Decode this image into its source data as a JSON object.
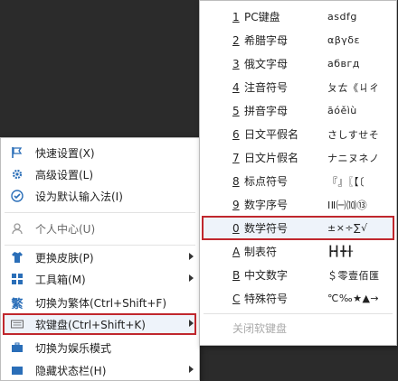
{
  "main_menu": {
    "items": [
      {
        "label": "快速设置(X)",
        "icon": "flag-icon"
      },
      {
        "label": "高级设置(L)",
        "icon": "gear-icon"
      },
      {
        "label": "设为默认输入法(I)",
        "icon": "check-circle-icon"
      },
      {
        "label": "个人中心(U)",
        "icon": "user-icon"
      },
      {
        "label": "更换皮肤(P)",
        "icon": "shirt-icon"
      },
      {
        "label": "工具箱(M)",
        "icon": "toolbox-icon"
      },
      {
        "label": "切换为繁体(Ctrl+Shift+F)",
        "icon": "traditional-char-icon"
      },
      {
        "label": "软键盘(Ctrl+Shift+K)",
        "icon": "keyboard-icon"
      },
      {
        "label": "切换为娱乐模式",
        "icon": "briefcase-icon"
      },
      {
        "label": "隐藏状态栏(H)",
        "icon": "hide-icon"
      }
    ]
  },
  "sub_menu": {
    "items": [
      {
        "num": "1",
        "name": "PC键盘",
        "sample": "asdfg"
      },
      {
        "num": "2",
        "name": "希腊字母",
        "sample": "αβγδε"
      },
      {
        "num": "3",
        "name": "俄文字母",
        "sample": "абвгд"
      },
      {
        "num": "4",
        "name": "注音符号",
        "sample": "ㄆㄊ《ㄐㄔ"
      },
      {
        "num": "5",
        "name": "拼音字母",
        "sample": "āóěìù"
      },
      {
        "num": "6",
        "name": "日文平假名",
        "sample": "さしすせそ"
      },
      {
        "num": "7",
        "name": "日文片假名",
        "sample": "ナニヌネノ"
      },
      {
        "num": "8",
        "name": "标点符号",
        "sample": "『』〖【〔"
      },
      {
        "num": "9",
        "name": "数字序号",
        "sample": "ⅠⅡ㈠⑽⑬"
      },
      {
        "num": "0",
        "name": "数学符号",
        "sample": "±×÷∑√"
      },
      {
        "num": "A",
        "name": "制表符",
        "sample": "┣┫╋╂"
      },
      {
        "num": "B",
        "name": "中文数字",
        "sample": "＄零壹佰匯"
      },
      {
        "num": "C",
        "name": "特殊符号",
        "sample": "℃‰★▲→"
      }
    ],
    "close_label": "关闭软键盘"
  },
  "colors": {
    "highlight_border": "#c0272d",
    "icon_blue": "#2a6eb8"
  }
}
